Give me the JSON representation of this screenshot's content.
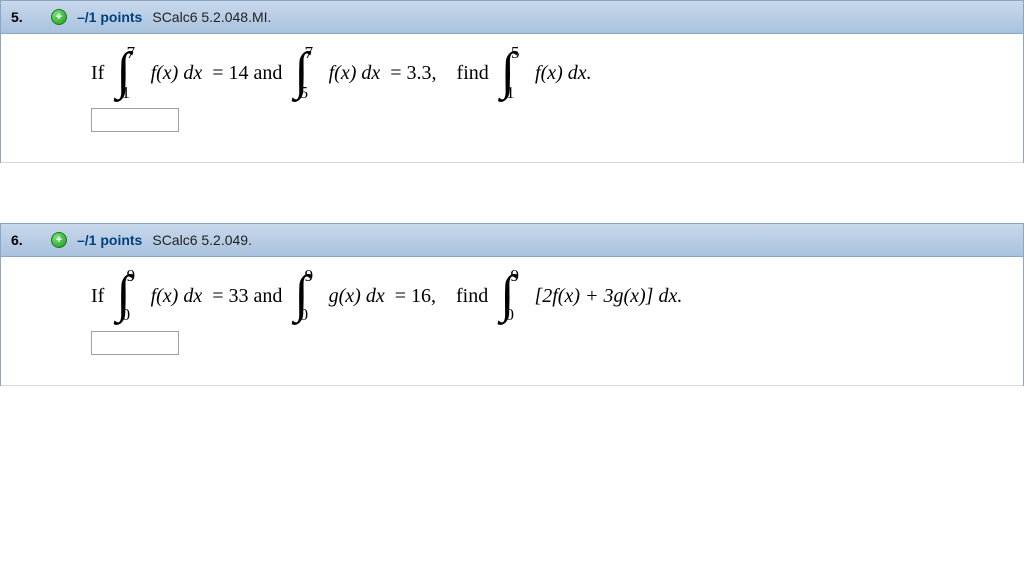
{
  "problems": [
    {
      "number": "5.",
      "points": "–/1 points",
      "ref": "SCalc6 5.2.048.MI.",
      "prefix": "If",
      "int1": {
        "lower": "1",
        "upper": "7",
        "body": "f(x) dx"
      },
      "eq1": " = 14  and",
      "int2": {
        "lower": "5",
        "upper": "7",
        "body": "f(x) dx"
      },
      "eq2": " = 3.3,",
      "find": "find",
      "int3": {
        "lower": "1",
        "upper": "5",
        "body": "f(x) dx."
      },
      "answer": ""
    },
    {
      "number": "6.",
      "points": "–/1 points",
      "ref": "SCalc6 5.2.049.",
      "prefix": "If",
      "int1": {
        "lower": "0",
        "upper": "9",
        "body": "f(x) dx"
      },
      "eq1": " = 33  and",
      "int2": {
        "lower": "0",
        "upper": "9",
        "body": "g(x) dx"
      },
      "eq2": " = 16,",
      "find": "find",
      "int3": {
        "lower": "0",
        "upper": "9",
        "body": "[2f(x) + 3g(x)] dx."
      },
      "answer": ""
    }
  ],
  "expand_glyph": "+"
}
